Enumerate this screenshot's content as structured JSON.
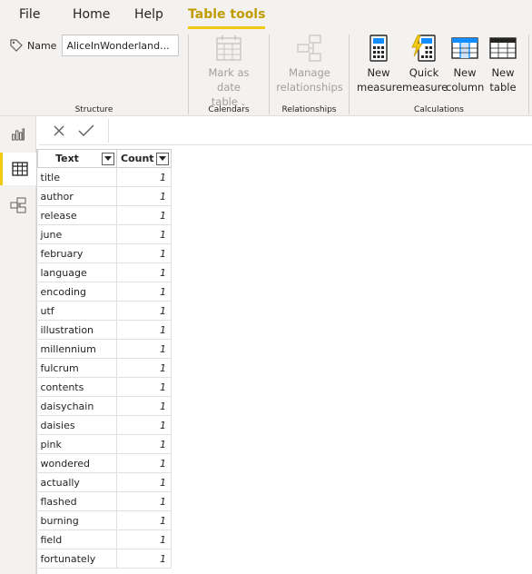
{
  "menu": {
    "tabs": [
      {
        "label": "File"
      },
      {
        "label": "Home"
      },
      {
        "label": "Help"
      },
      {
        "label": "Table tools"
      }
    ],
    "active_tab": "Table tools",
    "accent": "#f2c811"
  },
  "ribbon": {
    "structure": {
      "name_label": "Name",
      "name_value": "AliceInWonderland...",
      "group_label": "Structure"
    },
    "calendars": {
      "mark_as_date_table": {
        "line1": "Mark as date",
        "line2": "table",
        "icon": "calendar-grid-icon",
        "disabled": true
      },
      "group_label": "Calendars"
    },
    "relationships": {
      "manage_relationships": {
        "line1": "Manage",
        "line2": "relationships",
        "icon": "relationships-icon",
        "disabled": true
      },
      "group_label": "Relationships"
    },
    "calculations": {
      "new_measure": {
        "line1": "New",
        "line2": "measure",
        "icon": "calculator-icon"
      },
      "quick_measure": {
        "line1": "Quick",
        "line2": "measure",
        "icon": "lightning-calculator-icon"
      },
      "new_column": {
        "line1": "New",
        "line2": "column",
        "icon": "table-column-icon"
      },
      "new_table": {
        "line1": "New",
        "line2": "table",
        "icon": "table-icon"
      },
      "group_label": "Calculations"
    }
  },
  "rail": {
    "items": [
      {
        "name": "report-view",
        "icon": "bar-chart-icon"
      },
      {
        "name": "data-view",
        "icon": "table-grid-icon",
        "active": true
      },
      {
        "name": "model-view",
        "icon": "model-icon"
      }
    ]
  },
  "formula_bar": {
    "cancel_icon": "close-icon",
    "commit_icon": "check-icon",
    "value": ""
  },
  "table": {
    "columns": [
      "Text",
      "Count"
    ],
    "rows": [
      {
        "text": "title",
        "count": "1"
      },
      {
        "text": "author",
        "count": "1"
      },
      {
        "text": "release",
        "count": "1"
      },
      {
        "text": "june",
        "count": "1"
      },
      {
        "text": "february",
        "count": "1"
      },
      {
        "text": "language",
        "count": "1"
      },
      {
        "text": "encoding",
        "count": "1"
      },
      {
        "text": "utf",
        "count": "1"
      },
      {
        "text": "illustration",
        "count": "1"
      },
      {
        "text": "millennium",
        "count": "1"
      },
      {
        "text": "fulcrum",
        "count": "1"
      },
      {
        "text": "contents",
        "count": "1"
      },
      {
        "text": "daisychain",
        "count": "1"
      },
      {
        "text": "daisies",
        "count": "1"
      },
      {
        "text": "pink",
        "count": "1"
      },
      {
        "text": "wondered",
        "count": "1"
      },
      {
        "text": "actually",
        "count": "1"
      },
      {
        "text": "flashed",
        "count": "1"
      },
      {
        "text": "burning",
        "count": "1"
      },
      {
        "text": "field",
        "count": "1"
      },
      {
        "text": "fortunately",
        "count": "1"
      }
    ]
  }
}
